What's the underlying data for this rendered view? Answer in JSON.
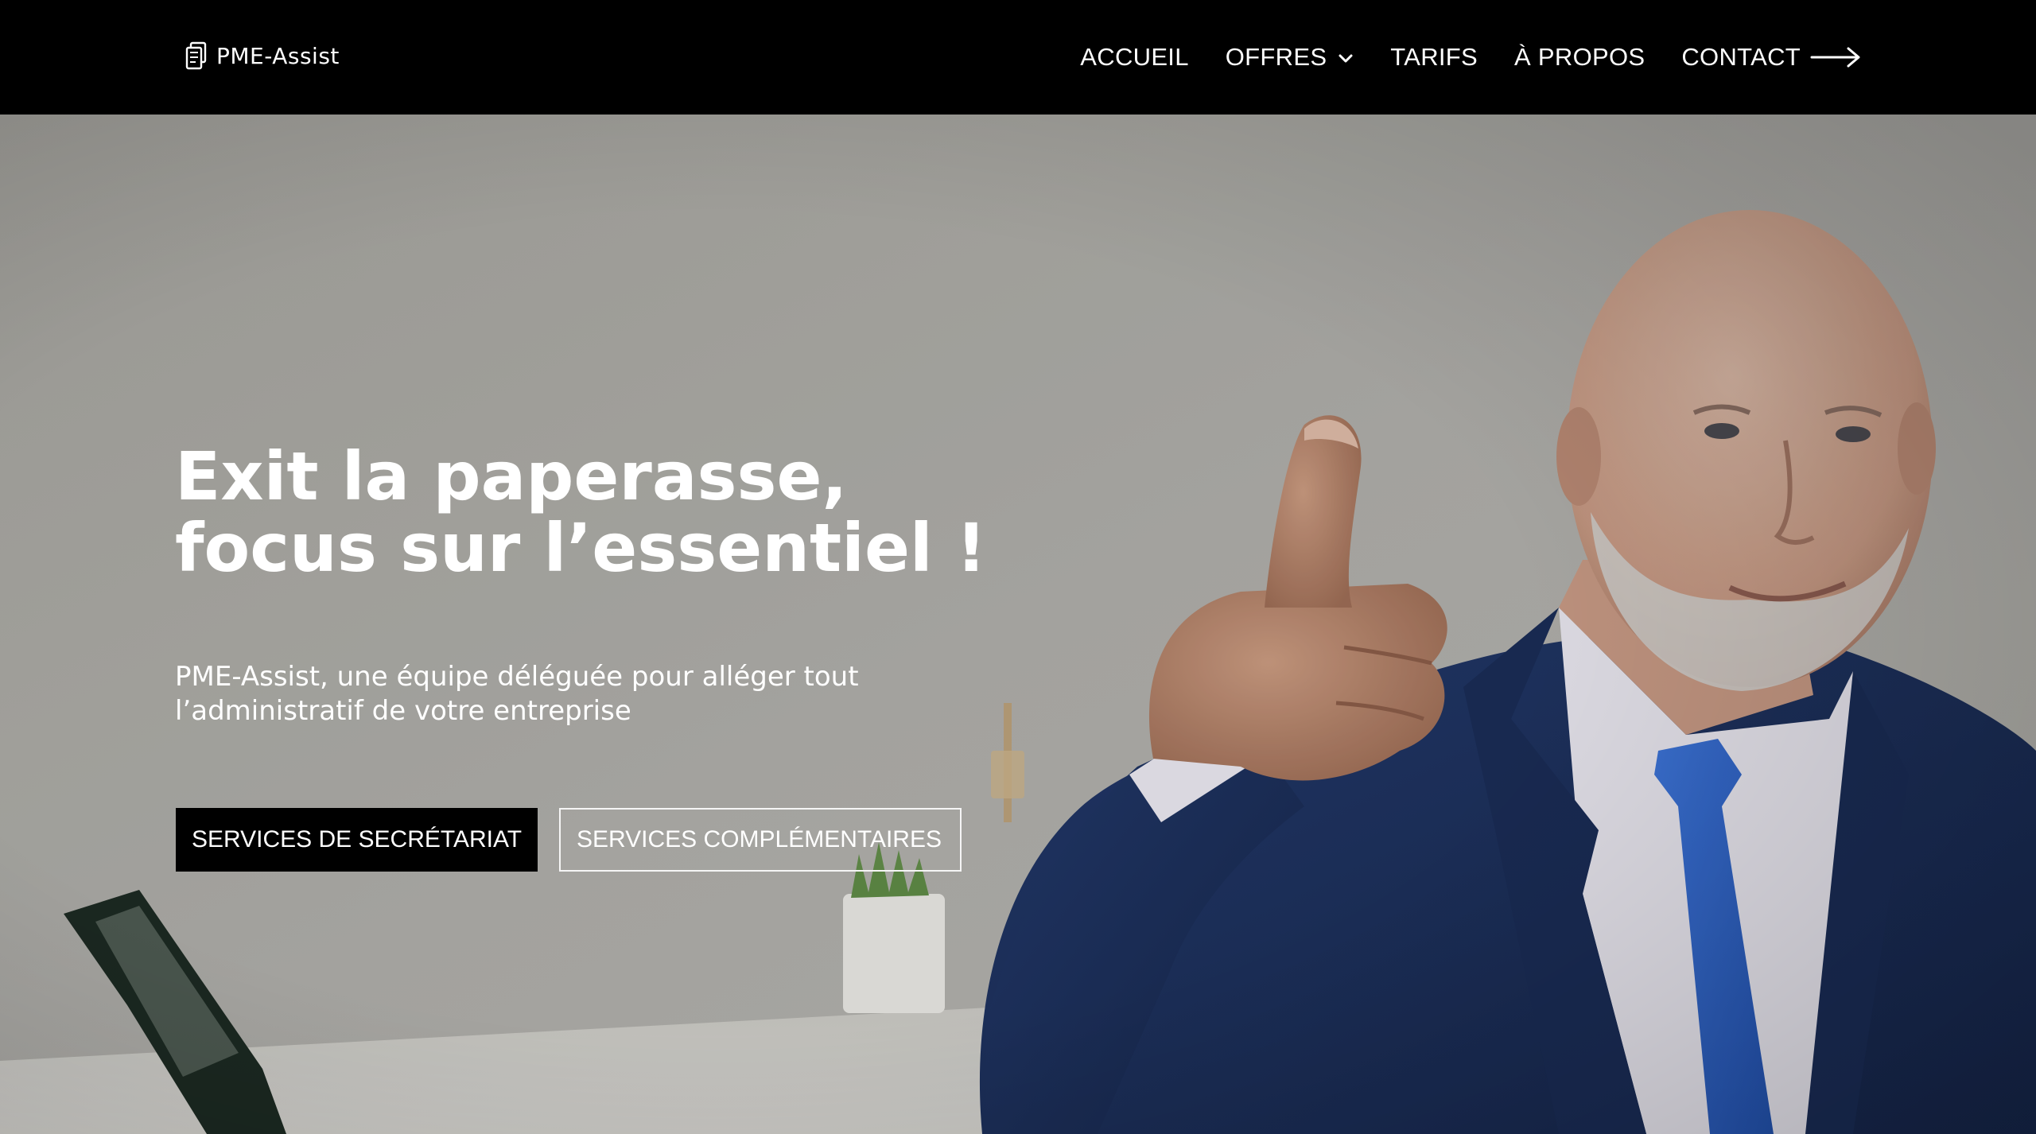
{
  "brand": {
    "name": "PME-Assist",
    "logo_icon": "documents-icon"
  },
  "nav": {
    "items": [
      {
        "label": "ACCUEIL"
      },
      {
        "label": "OFFRES",
        "icon": "chevron-down-icon"
      },
      {
        "label": "TARIFS"
      },
      {
        "label": "À PROPOS"
      },
      {
        "label": "CONTACT",
        "icon": "long-arrow-right-icon"
      }
    ]
  },
  "hero": {
    "headline_line1": "Exit la paperasse,",
    "headline_line2": "focus sur l’essentiel !",
    "subtitle_line1": "PME-Assist, une équipe déléguée pour alléger tout",
    "subtitle_line2": "l’administratif de votre entreprise",
    "primary_cta": "SERVICES DE SECRÉTARIAT",
    "secondary_cta": "SERVICES COMPLÉMENTAIRES",
    "cta_icon": "arrow-right-icon",
    "background_description_icon": "businessman-thumbs-up-photo"
  },
  "colors": {
    "nav_bg": "#000000",
    "text": "#ffffff",
    "suit": "#1f3a6e",
    "tie": "#2f63c9",
    "wall": "#a7a6a1"
  }
}
